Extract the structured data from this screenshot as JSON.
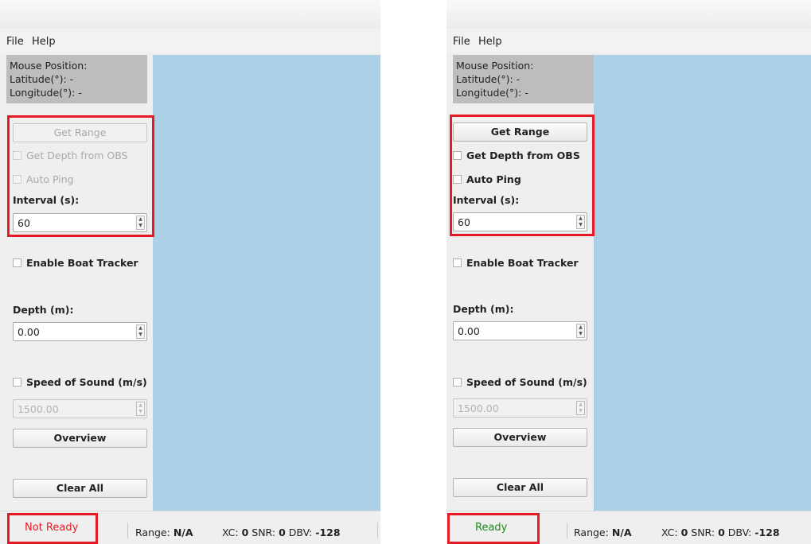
{
  "left": {
    "menu": [
      "File",
      "Help"
    ],
    "mouse_position": {
      "title": "Mouse Position:",
      "latitude": "Latitude(°): -",
      "longitude": "Longitude(°): -"
    },
    "get_range": "Get Range",
    "get_depth_obs": "Get Depth from OBS",
    "auto_ping": "Auto Ping",
    "interval_label": "Interval (s):",
    "interval_value": "60",
    "boat_tracker": "Enable Boat Tracker",
    "depth_label": "Depth (m):",
    "depth_value": "0.00",
    "speed_sound": "Speed of Sound (m/s)",
    "speed_value": "1500.00",
    "overview": "Overview",
    "clear_all": "Clear All",
    "status": "Not Ready",
    "range_label": "Range:",
    "range_value": "N/A",
    "xc_label": "XC:",
    "xc_value": "0",
    "snr_label": "SNR:",
    "snr_value": "0",
    "dbv_label": "DBV:",
    "dbv_value": "-128"
  },
  "right": {
    "menu": [
      "File",
      "Help"
    ],
    "mouse_position": {
      "title": "Mouse Position:",
      "latitude": "Latitude(°): -",
      "longitude": "Longitude(°): -"
    },
    "get_range": "Get Range",
    "get_depth_obs": "Get Depth from OBS",
    "auto_ping": "Auto Ping",
    "interval_label": "Interval (s):",
    "interval_value": "60",
    "boat_tracker": "Enable Boat Tracker",
    "depth_label": "Depth (m):",
    "depth_value": "0.00",
    "speed_sound": "Speed of Sound (m/s)",
    "speed_value": "1500.00",
    "overview": "Overview",
    "clear_all": "Clear All",
    "status": "Ready",
    "range_label": "Range:",
    "range_value": "N/A",
    "xc_label": "XC:",
    "xc_value": "0",
    "snr_label": "SNR:",
    "snr_value": "0",
    "dbv_label": "DBV:",
    "dbv_value": "-128"
  },
  "colors": {
    "highlight": "#e51a25",
    "not_ready": "#e51a25",
    "ready": "#1a8a1a",
    "map": "#acd1e6"
  }
}
